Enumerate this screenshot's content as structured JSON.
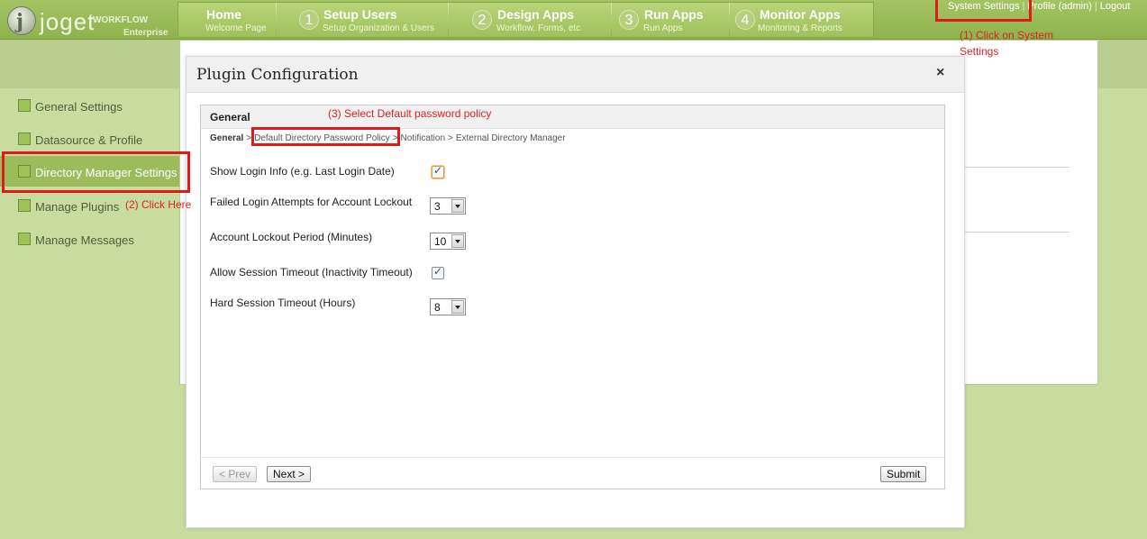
{
  "header": {
    "logo": {
      "word": "joget",
      "sub": "WORKFLOW",
      "edition": "Enterprise"
    },
    "nav": [
      {
        "number": "",
        "title": "Home",
        "subtitle": "Welcome Page"
      },
      {
        "number": "1",
        "title": "Setup Users",
        "subtitle": "Setup Organization & Users"
      },
      {
        "number": "2",
        "title": "Design Apps",
        "subtitle": "Workflow, Forms, etc"
      },
      {
        "number": "3",
        "title": "Run Apps",
        "subtitle": "Run Apps"
      },
      {
        "number": "4",
        "title": "Monitor Apps",
        "subtitle": "Monitoring & Reports"
      }
    ],
    "user_links": {
      "system_settings": "System Settings",
      "profile": "Profile (admin)",
      "logout": "Logout",
      "separator": "|"
    }
  },
  "annotations": {
    "step1_line1": "(1) Click on System",
    "step1_line2": "Settings",
    "step2": "(2) Click Here",
    "step3": "(3) Select Default password policy"
  },
  "sidebar": {
    "items": [
      {
        "label": "General Settings"
      },
      {
        "label": "Datasource & Profile"
      },
      {
        "label": "Directory Manager Settings"
      },
      {
        "label": "Manage Plugins"
      },
      {
        "label": "Manage Messages"
      }
    ]
  },
  "modal": {
    "title": "Plugin Configuration",
    "close": "×",
    "tab": "General",
    "breadcrumb": {
      "current": "General",
      "items": [
        "Default Directory Password Policy",
        "Notification",
        "External Directory Manager"
      ],
      "separator": ">"
    },
    "fields": [
      {
        "label": "Show Login Info (e.g. Last Login Date)",
        "type": "checkbox",
        "checked": true
      },
      {
        "label": "Failed Login Attempts for Account Lockout",
        "type": "select",
        "value": "3"
      },
      {
        "label": "Account Lockout Period (Minutes)",
        "type": "select",
        "value": "10"
      },
      {
        "label": "Allow Session Timeout (Inactivity Timeout)",
        "type": "checkbox",
        "checked": true
      },
      {
        "label": "Hard Session Timeout (Hours)",
        "type": "select",
        "value": "8"
      }
    ],
    "buttons": {
      "prev": "< Prev",
      "next": "Next >",
      "submit": "Submit"
    }
  },
  "colors": {
    "highlight": "#e01a1a",
    "annotation": "#dd2222",
    "brand_green": "#9fc15a"
  }
}
